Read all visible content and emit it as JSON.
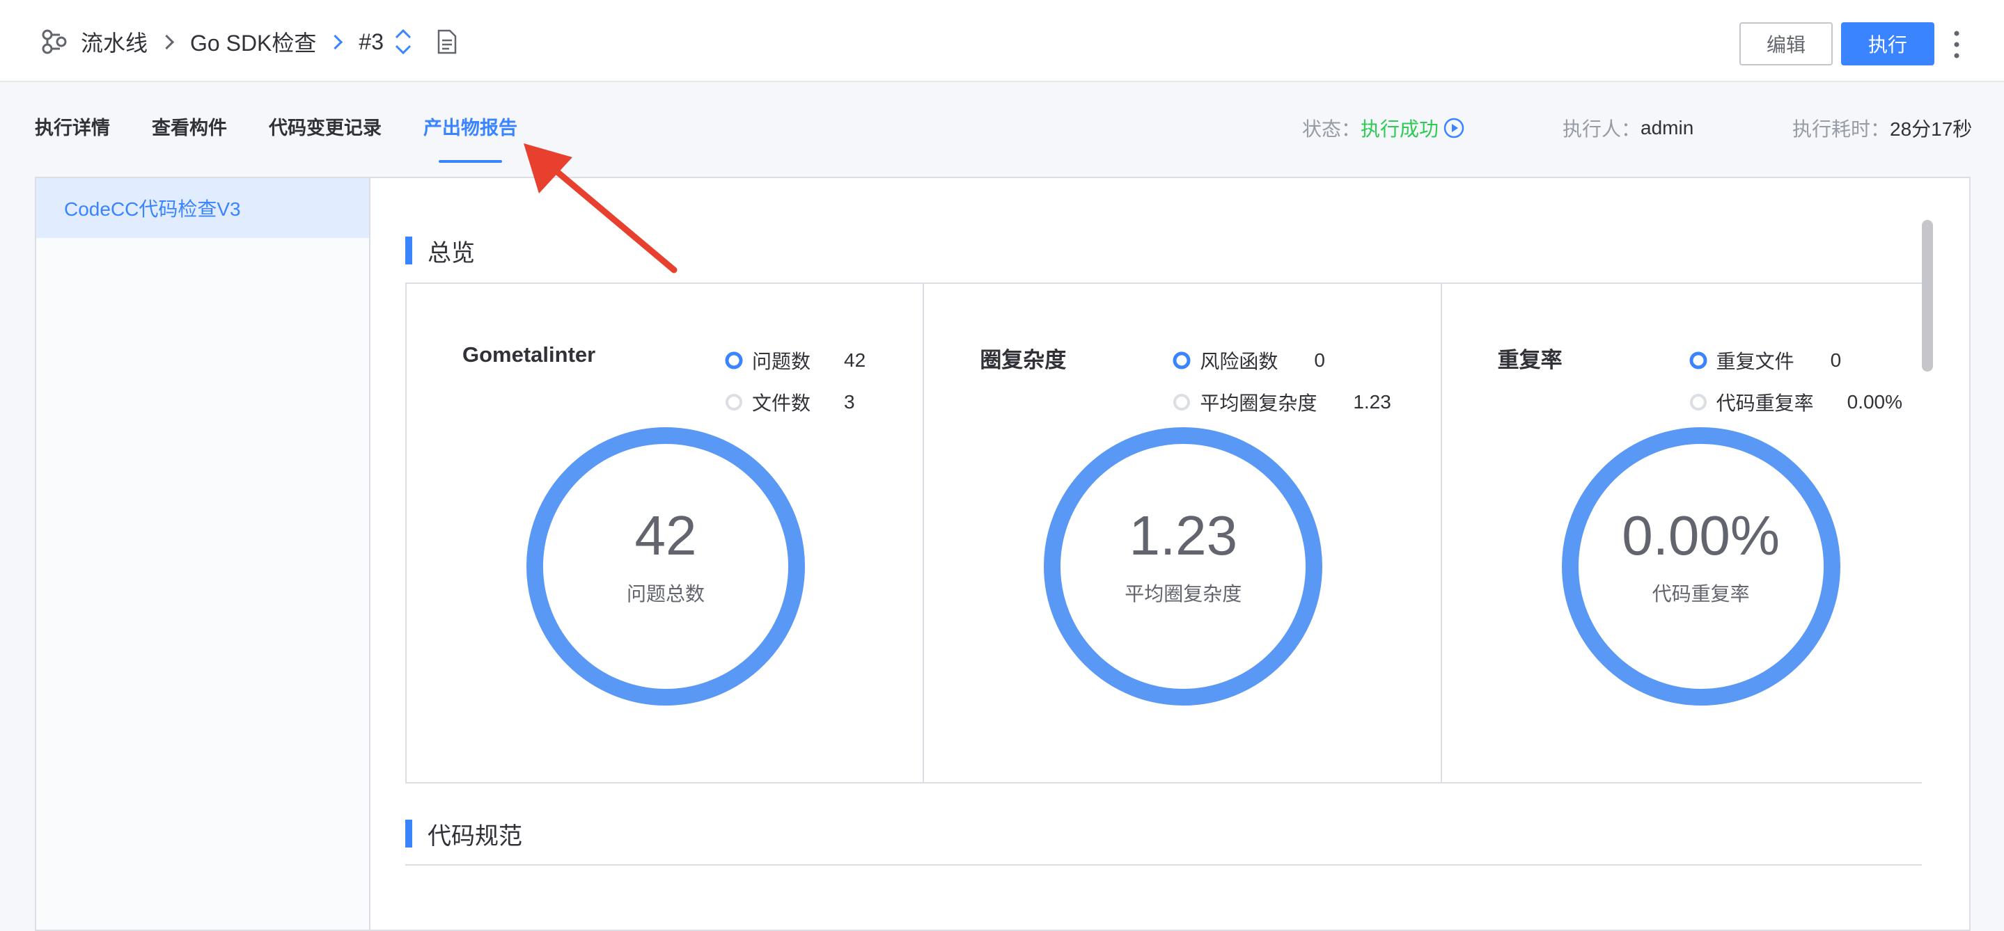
{
  "header": {
    "breadcrumb": {
      "root": "流水线",
      "pipeline": "Go SDK检查",
      "build": "#3"
    },
    "icons": {
      "root": "pipeline-icon",
      "switch": "updown-icon",
      "log": "doc-icon",
      "more": "more-vertical-icon"
    },
    "edit_label": "编辑",
    "run_label": "执行"
  },
  "tabs": [
    "执行详情",
    "查看构件",
    "代码变更记录",
    "产出物报告"
  ],
  "active_tab": "产出物报告",
  "status": {
    "status_label": "状态：",
    "status_value": "执行成功",
    "executor_label": "执行人：",
    "executor_value": "admin",
    "duration_label": "执行耗时：",
    "duration_value": "28分17秒"
  },
  "sidebar": {
    "items": [
      "CodeCC代码检查V3"
    ]
  },
  "sections": {
    "overview": "总览",
    "code_standard": "代码规范"
  },
  "cards": [
    {
      "title": "Gometalinter",
      "legend": [
        {
          "label": "问题数",
          "value": "42",
          "selected": true
        },
        {
          "label": "文件数",
          "value": "3",
          "selected": false
        }
      ],
      "ring_value": "42",
      "ring_label": "问题总数"
    },
    {
      "title": "圈复杂度",
      "legend": [
        {
          "label": "风险函数",
          "value": "0",
          "selected": true
        },
        {
          "label": "平均圈复杂度",
          "value": "1.23",
          "selected": false
        }
      ],
      "ring_value": "1.23",
      "ring_label": "平均圈复杂度"
    },
    {
      "title": "重复率",
      "legend": [
        {
          "label": "重复文件",
          "value": "0",
          "selected": true
        },
        {
          "label": "代码重复率",
          "value": "0.00%",
          "selected": false
        }
      ],
      "ring_value": "0.00%",
      "ring_label": "代码重复率"
    }
  ],
  "colors": {
    "accent": "#3a84ff",
    "success": "#2dcb56",
    "ring": "#5a98f5",
    "annotation_arrow": "#e8402e"
  }
}
